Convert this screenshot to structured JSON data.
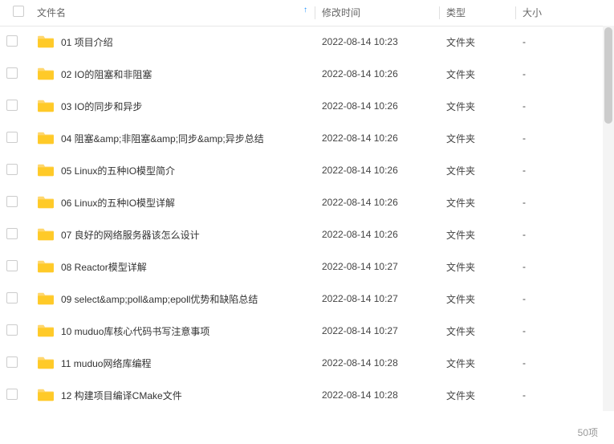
{
  "columns": {
    "name": "文件名",
    "mtime": "修改时间",
    "type": "类型",
    "size": "大小"
  },
  "rows": [
    {
      "name": "01 项目介绍",
      "mtime": "2022-08-14 10:23",
      "type": "文件夹",
      "size": "-"
    },
    {
      "name": "02 IO的阻塞和非阻塞",
      "mtime": "2022-08-14 10:26",
      "type": "文件夹",
      "size": "-"
    },
    {
      "name": "03 IO的同步和异步",
      "mtime": "2022-08-14 10:26",
      "type": "文件夹",
      "size": "-"
    },
    {
      "name": "04 阻塞&amp;非阻塞&amp;同步&amp;异步总结",
      "mtime": "2022-08-14 10:26",
      "type": "文件夹",
      "size": "-"
    },
    {
      "name": "05 Linux的五种IO模型简介",
      "mtime": "2022-08-14 10:26",
      "type": "文件夹",
      "size": "-"
    },
    {
      "name": "06 Linux的五种IO模型详解",
      "mtime": "2022-08-14 10:26",
      "type": "文件夹",
      "size": "-"
    },
    {
      "name": "07 良好的网络服务器该怎么设计",
      "mtime": "2022-08-14 10:26",
      "type": "文件夹",
      "size": "-"
    },
    {
      "name": "08 Reactor模型详解",
      "mtime": "2022-08-14 10:27",
      "type": "文件夹",
      "size": "-"
    },
    {
      "name": "09 select&amp;poll&amp;epoll优势和缺陷总结",
      "mtime": "2022-08-14 10:27",
      "type": "文件夹",
      "size": "-"
    },
    {
      "name": "10 muduo库核心代码书写注意事项",
      "mtime": "2022-08-14 10:27",
      "type": "文件夹",
      "size": "-"
    },
    {
      "name": "11 muduo网络库编程",
      "mtime": "2022-08-14 10:28",
      "type": "文件夹",
      "size": "-"
    },
    {
      "name": "12 构建项目编译CMake文件",
      "mtime": "2022-08-14 10:28",
      "type": "文件夹",
      "size": "-"
    }
  ],
  "footer": {
    "count": "50项"
  }
}
